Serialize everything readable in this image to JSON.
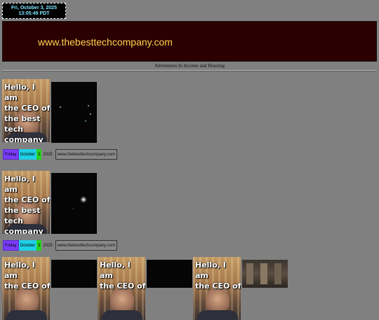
{
  "clock": {
    "date": "Fri, October 3, 2025",
    "time": "13:05:49 PDT"
  },
  "banner": {
    "url": "www.thebesttechcompany.com"
  },
  "tagline": "Adventures In Income and Housing",
  "ceo_caption": [
    "Hello, I am",
    "the CEO of",
    "the best",
    "tech",
    "company"
  ],
  "datebar": {
    "day": "Friday",
    "month": "October",
    "daynum": "3",
    "year": "2025",
    "site": "www.thebesttechcompany.com"
  },
  "colors": {
    "background": "#808080",
    "banner_bg": "#2b0000",
    "banner_text": "#ffd24d",
    "clock_text": "#7fe6ff",
    "day_bg": "#7b3cff",
    "month_bg": "#1fd0e6",
    "daynum_bg": "#2ad024"
  }
}
